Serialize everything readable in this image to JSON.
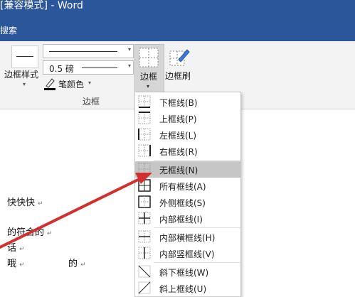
{
  "titlebar": {
    "title": "[兼容模式] - Word"
  },
  "tabbar": {
    "search": "搜索"
  },
  "ribbon": {
    "border_style_label": "边框样式",
    "pen_weight": "0.5 磅",
    "pen_color_label": "笔颜色",
    "borders_label": "边框",
    "painter_label": "边框刷",
    "group_label": "边框"
  },
  "document": {
    "lines": [
      "快快快",
      "的符合的",
      "话",
      "哦",
      "的"
    ]
  },
  "dropdown": {
    "items": [
      {
        "label": "下框线(B)",
        "icon": "bottom-border-icon"
      },
      {
        "label": "上框线(P)",
        "icon": "top-border-icon"
      },
      {
        "label": "左框线(L)",
        "icon": "left-border-icon"
      },
      {
        "label": "右框线(R)",
        "icon": "right-border-icon"
      },
      {
        "label": "无框线(N)",
        "icon": "no-border-icon",
        "highlighted": true
      },
      {
        "label": "所有框线(A)",
        "icon": "all-borders-icon"
      },
      {
        "label": "外侧框线(S)",
        "icon": "outside-borders-icon"
      },
      {
        "label": "内部框线(I)",
        "icon": "inside-borders-icon"
      },
      {
        "label": "内部横框线(H)",
        "icon": "inside-horizontal-border-icon"
      },
      {
        "label": "内部竖框线(V)",
        "icon": "inside-vertical-border-icon"
      },
      {
        "label": "斜下框线(W)",
        "icon": "diagonal-down-border-icon"
      },
      {
        "label": "斜上框线(U)",
        "icon": "diagonal-up-border-icon"
      }
    ]
  },
  "colors": {
    "title_bar": "#2b579a",
    "arrow": "#d32f2f",
    "pen_red": "#c00000"
  }
}
